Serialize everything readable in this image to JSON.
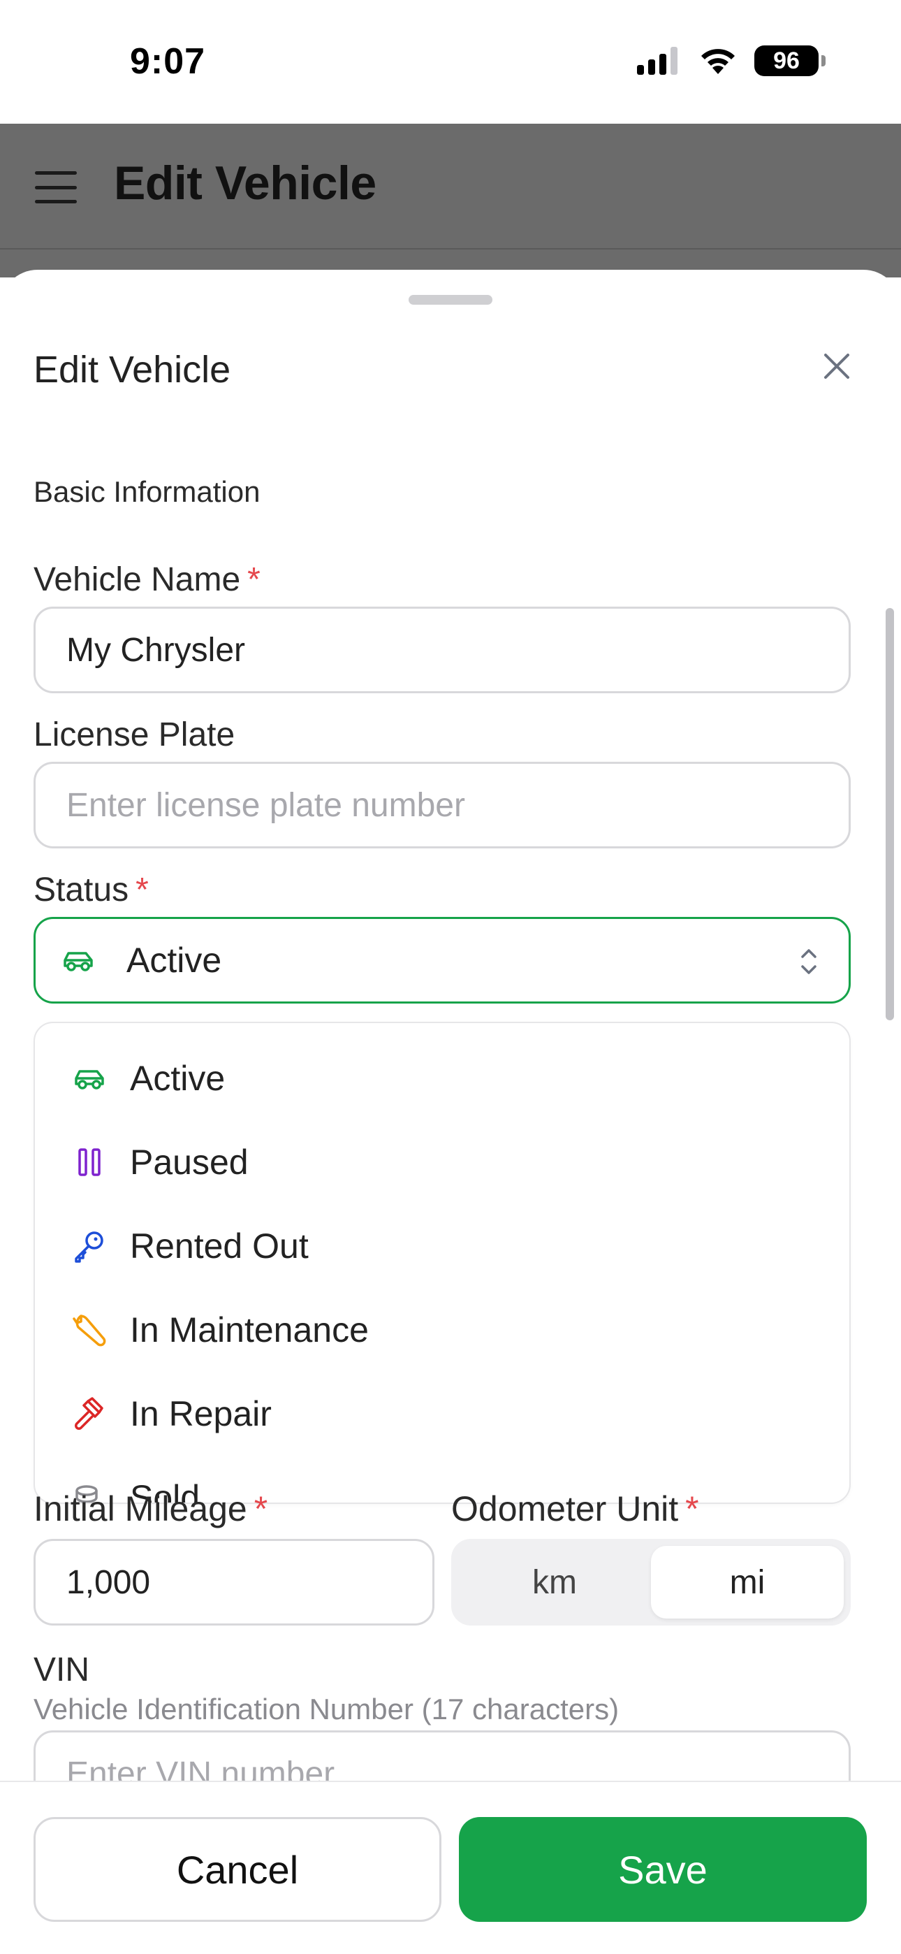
{
  "status_bar": {
    "time": "9:07",
    "battery": "96"
  },
  "app_header": {
    "title": "Edit Vehicle"
  },
  "sheet": {
    "title": "Edit Vehicle",
    "section": "Basic Information",
    "vehicle_name": {
      "label": "Vehicle Name",
      "required_mark": "*",
      "value": "My Chrysler"
    },
    "license_plate": {
      "label": "License Plate",
      "placeholder": "Enter license plate number"
    },
    "status": {
      "label": "Status",
      "required_mark": "*",
      "selected": "Active",
      "options": [
        {
          "label": "Active",
          "icon": "car-icon",
          "color": "#16a34a"
        },
        {
          "label": "Paused",
          "icon": "pause-icon",
          "color": "#7e22ce"
        },
        {
          "label": "Rented Out",
          "icon": "key-icon",
          "color": "#1d4ed8"
        },
        {
          "label": "In Maintenance",
          "icon": "wrench-icon",
          "color": "#f59e0b"
        },
        {
          "label": "In Repair",
          "icon": "hammer-icon",
          "color": "#dc2626"
        },
        {
          "label": "Sold",
          "icon": "coins-icon",
          "color": "#8a8a8f"
        }
      ]
    },
    "initial_mileage": {
      "label": "Initial Mileage",
      "required_mark": "*",
      "value": "1,000"
    },
    "odometer_unit": {
      "label": "Odometer Unit",
      "required_mark": "*",
      "options": [
        "km",
        "mi"
      ],
      "selected": "mi"
    },
    "vin": {
      "label": "VIN",
      "help": "Vehicle Identification Number (17 characters)",
      "placeholder": "Enter VIN number"
    }
  },
  "footer": {
    "cancel": "Cancel",
    "save": "Save"
  },
  "colors": {
    "accent": "#16a34a",
    "required": "#e5484d",
    "overlay": "#6b6b6b"
  }
}
